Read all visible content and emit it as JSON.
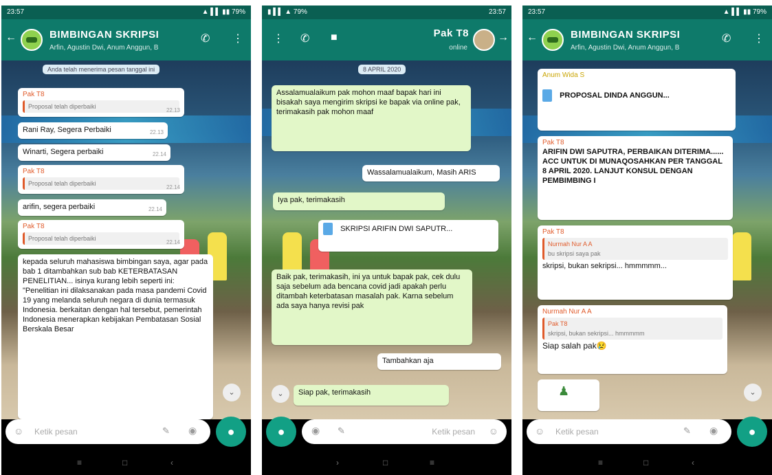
{
  "colors": {
    "header": "#0e7a6a",
    "status": "#0a5f52",
    "accent": "#12a085",
    "bubble_out": "#e2f7c8",
    "sender": "#e05a2a"
  },
  "phone1": {
    "status_time": "23:57",
    "title": "BIMBINGAN SKRIPSI",
    "subtitle": "Arfin, Agustin Dwi, Anum Anggun, B",
    "system_msg": "Anda telah menerima pesan tanggal ini",
    "bubbles": [
      {
        "sender": "Pak T8",
        "quote": "Proposal telah diperbaiki",
        "time": "22.13"
      },
      {
        "text": "Rani Ray, Segera Perbaiki",
        "time": "22.13"
      },
      {
        "text": "Winarti, Segera perbaiki",
        "time": "22.14"
      },
      {
        "sender": "Pak T8",
        "quote": "Proposal telah diperbaiki",
        "time": "22.14"
      },
      {
        "text": "arifin, segera perbaiki",
        "time": "22.14"
      },
      {
        "sender": "Pak T8",
        "quote": "Proposal telah diperbaiki",
        "time": "22.14"
      }
    ],
    "long_msg": "kepada seluruh mahasiswa bimbingan saya, agar pada bab 1 ditambahkan sub bab KETERBATASAN PENELITIAN... isinya kurang lebih seperti ini: \"Penelitian ini dilaksanakan pada masa pandemi Covid 19 yang melanda seluruh negara di dunia termasuk Indonesia. berkaitan dengan hal tersebut, pemerintah Indonesia menerapkan kebijakan Pembatasan Sosial Berskala Besar",
    "input_placeholder": "Ketik pesan"
  },
  "phone2": {
    "status_time": "23:57",
    "contact": "Pak T8",
    "contact_status": "online",
    "date_pill": "8 APRIL 2020",
    "msg_long1": "Assalamualaikum pak mohon maaf bapak hari ini bisakah saya mengirim skripsi ke bapak via online pak, terimakasih pak mohon maaf",
    "msg_reply1": "Wassalamualaikum, Masih ARIS",
    "msg_thanks1": "Iya pak, terimakasih",
    "doc_name": "SKRIPSI ARIFIN DWI SAPUTR...",
    "msg_long2": "Baik pak, terimakasih, ini ya untuk bapak pak, cek dulu saja sebelum ada bencana covid jadi apakah perlu ditambah keterbatasan masalah pak. Karna sebelum ada saya hanya revisi pak",
    "msg_reply2": "Tambahkan aja",
    "msg_thanks2": "Siap pak, terimakasih",
    "input_placeholder": "Ketik pesan"
  },
  "phone3": {
    "status_time": "23:57",
    "title": "BIMBINGAN SKRIPSI",
    "subtitle": "Arfin, Agustin Dwi, Anum Anggun, B",
    "sender_top": "Anum Wida S",
    "doc_name": "PROPOSAL DINDA ANGGUN...",
    "sender_main": "Pak T8",
    "msg_main": "ARIFIN DWI SAPUTRA, PERBAIKAN DITERIMA...... ACC UNTUK DI MUNAQOSAHKAN PER TANGGAL 8 APRIL 2020. LANJUT KONSUL DENGAN PEMBIMBING I",
    "sender_reply1": "Pak T8",
    "quote_reply1_name": "Nurmah Nur A A",
    "quote_reply1_text": "bu skripsi saya pak",
    "msg_reply1": "skripsi, bukan sekripsi... hmmmmm...",
    "sender_reply2": "Nurmah Nur A A",
    "quote_reply2_name": "Pak T8",
    "quote_reply2_text": "skripsi, bukan sekripsi... hmmmmm",
    "msg_reply2": "Siap salah pak😢",
    "input_placeholder": "Ketik pesan"
  }
}
